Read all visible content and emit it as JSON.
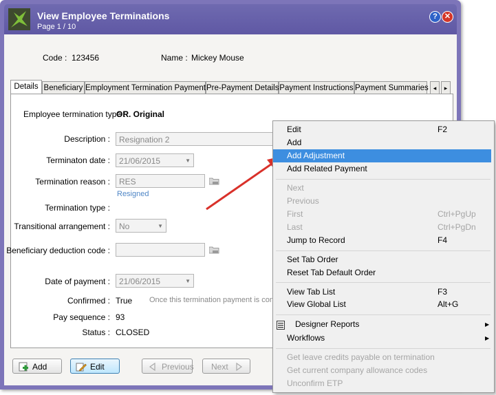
{
  "window": {
    "title": "View Employee Terminations",
    "page": "Page 1 / 10",
    "help": "?",
    "close": "✕"
  },
  "header": {
    "code_label": "Code :",
    "code_value": "123456",
    "name_label": "Name :",
    "name_value": "Mickey Mouse"
  },
  "tabs": [
    "Details",
    "Beneficiary",
    "Employment Termination Payments",
    "Pre-Payment Details",
    "Payment Instructions",
    "Payment Summaries"
  ],
  "tab_scroll": {
    "left": "◂",
    "right": "▸"
  },
  "form": {
    "termination_type_label": "Employee termination type :",
    "termination_type_value": "OR. Original",
    "description_label": "Description :",
    "description_value": "Resignation 2",
    "termination_date_label": "Terminaton date :",
    "termination_date_value": "21/06/2015",
    "termination_reason_label": "Termination reason :",
    "termination_reason_value": "RES",
    "termination_reason_desc": "Resigned",
    "termination_type2_label": "Termination type :",
    "transitional_label": "Transitional arrangement :",
    "transitional_value": "No",
    "beneficiary_label": "Beneficiary deduction code :",
    "date_payment_label": "Date of payment :",
    "date_payment_value": "21/06/2015",
    "confirmed_label": "Confirmed :",
    "confirmed_value": "True",
    "confirmed_note": "Once this termination payment is confi",
    "pay_sequence_label": "Pay sequence :",
    "pay_sequence_value": "93",
    "status_label": "Status :",
    "status_value": "CLOSED"
  },
  "buttons": {
    "add": "Add",
    "edit": "Edit",
    "previous": "Previous",
    "next": "Next"
  },
  "context_menu": {
    "items": [
      {
        "label": "Edit",
        "shortcut": "F2"
      },
      {
        "label": "Add",
        "shortcut": ""
      },
      {
        "label": "Add Adjustment",
        "shortcut": ""
      },
      {
        "label": "Add Related Payment",
        "shortcut": ""
      },
      {
        "label": "Next",
        "shortcut": ""
      },
      {
        "label": "Previous",
        "shortcut": ""
      },
      {
        "label": "First",
        "shortcut": "Ctrl+PgUp"
      },
      {
        "label": "Last",
        "shortcut": "Ctrl+PgDn"
      },
      {
        "label": "Jump to Record",
        "shortcut": "F4"
      },
      {
        "label": "Set Tab Order",
        "shortcut": ""
      },
      {
        "label": "Reset Tab Default Order",
        "shortcut": ""
      },
      {
        "label": "View Tab List",
        "shortcut": "F3"
      },
      {
        "label": "View Global List",
        "shortcut": "Alt+G"
      },
      {
        "label": "Designer Reports",
        "shortcut": ""
      },
      {
        "label": "Workflows",
        "shortcut": ""
      },
      {
        "label": "Get leave credits payable on termination",
        "shortcut": ""
      },
      {
        "label": "Get current company allowance codes",
        "shortcut": ""
      },
      {
        "label": "Unconfirm ETP",
        "shortcut": ""
      }
    ],
    "submenu_arrow": "▶"
  },
  "colors": {
    "title_bar": "#5f58a4",
    "menu_highlight": "#3d8ee0",
    "annotation_arrow": "#d9312a"
  }
}
